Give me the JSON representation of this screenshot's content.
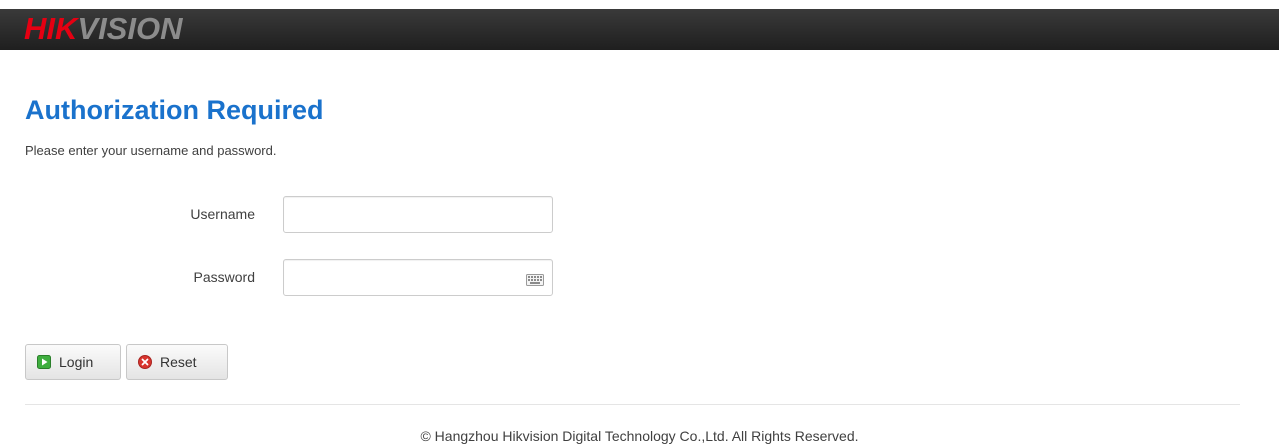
{
  "header": {
    "logo_hik": "HIK",
    "logo_vision": "VISION"
  },
  "page": {
    "title": "Authorization Required",
    "subtitle": "Please enter your username and password."
  },
  "form": {
    "username_label": "Username",
    "username_value": "",
    "password_label": "Password",
    "password_value": ""
  },
  "buttons": {
    "login": "Login",
    "reset": "Reset"
  },
  "icons": {
    "login": "play-icon",
    "reset": "close-icon",
    "keyboard": "keyboard-icon"
  },
  "colors": {
    "brand_red": "#e60012",
    "title_blue": "#1a72cc",
    "header_bg": "#262626"
  },
  "footer": {
    "copyright": "© Hangzhou Hikvision Digital Technology Co.,Ltd. All Rights Reserved."
  }
}
